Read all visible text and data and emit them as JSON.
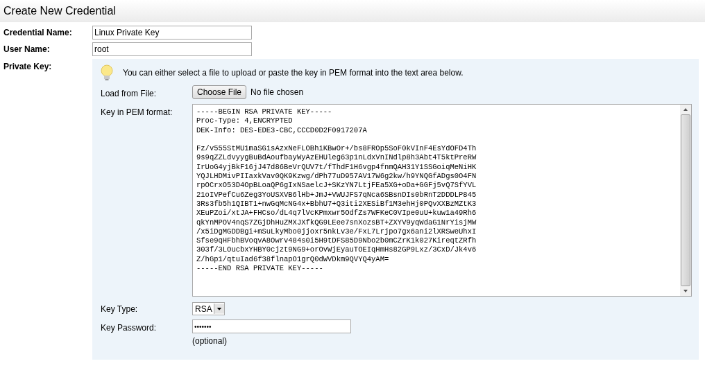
{
  "title": "Create New Credential",
  "credential_name": {
    "label": "Credential Name:",
    "value": "Linux Private Key"
  },
  "user_name": {
    "label": "User Name:",
    "value": "root"
  },
  "private_key": {
    "label": "Private Key:",
    "hint": "You can either select a file to upload or paste the key in PEM format into the text area below.",
    "load_from_file": {
      "label": "Load from File:",
      "button": "Choose File",
      "status": "No file chosen"
    },
    "pem": {
      "label": "Key in PEM format:",
      "header_lines": [
        "-----BEGIN RSA PRIVATE KEY-----",
        "Proc-Type: 4,ENCRYPTED",
        "DEK-Info: DES-EDE3-CBC,CCCD0D2F0917207A"
      ],
      "body_lines": [
        "Fz/v555StMU1maSGisAzxNeFLOBhiKBwOr+/bs8FROp5SoF0kVInF4EsYdOFD4Th",
        "9s9qZZLdvyygBuBdAoufbayWyAzEHUleg63p1nLdxVnINdlp8h3Abt4T5ktPreRW",
        "IrUoG4yjBkF16jJ47d86BeVrQUV7t/fThdF1H6vgp4fnmQAH31Y1SSGoiqMeNiHK",
        "YQJLHDMivPIIaxkVav0QK9Kzwg/dPh77uD957AV17W6g2kw/h9YNQGfADgs0O4FN",
        "rpOCrxO53D4OpBLoaQP6gIxNSaelcJ+SKzYN7LtjFEa5XG+oDa+GGFj5vQ7SfYVL",
        "21oIVPefCu6Zeg3YoUSXVB6lHb+JmJ+VWUJFS7qNca6SBsnDIs0bRnT2DDDLP845",
        "3Rs3fb5h1QIBT1+nwGqMcNG4x+BbhU7+Q3iti2XESiBf1M3ehHj0PQvXXBzMZtK3",
        "XEuPZoi/xtJA+FHCso/dL4q7lVcKPmxwr5OdfZs7WFKeC0VIpe0uU+kuw1a49Rh6",
        "qkYnMPOV4nqS7ZGjDhHuZMXJXfkQG9LEee7snXozsBT+ZXYV9yqWdaG1NrYisjMW",
        "/x5iDgMGDDBgi+mSuLkyMbo0jjoxr5nkLv3e/FxL7Lrjpo7gx6ani2lXRSweUhxI",
        "Sfse9qHFbhBVoqvA8Owrv484s0i5H9tDFS85D9Nbo2b0mCZrK1k027KireqtZRfh",
        "303f/3LOucbxYHBY0cjzt9NG9+orOvWjEyauTOEIqHmHs82GP9Lxz/3CxD/Jk4v6",
        "Z/hGp1/qtuIad6f38flnapO1grQ0dWVDkm9QVYQ4yAM=",
        "-----END RSA PRIVATE KEY-----"
      ]
    },
    "key_type": {
      "label": "Key Type:",
      "value": "RSA"
    },
    "key_password": {
      "label": "Key Password:",
      "value": "•••••••",
      "note": "(optional)"
    }
  }
}
